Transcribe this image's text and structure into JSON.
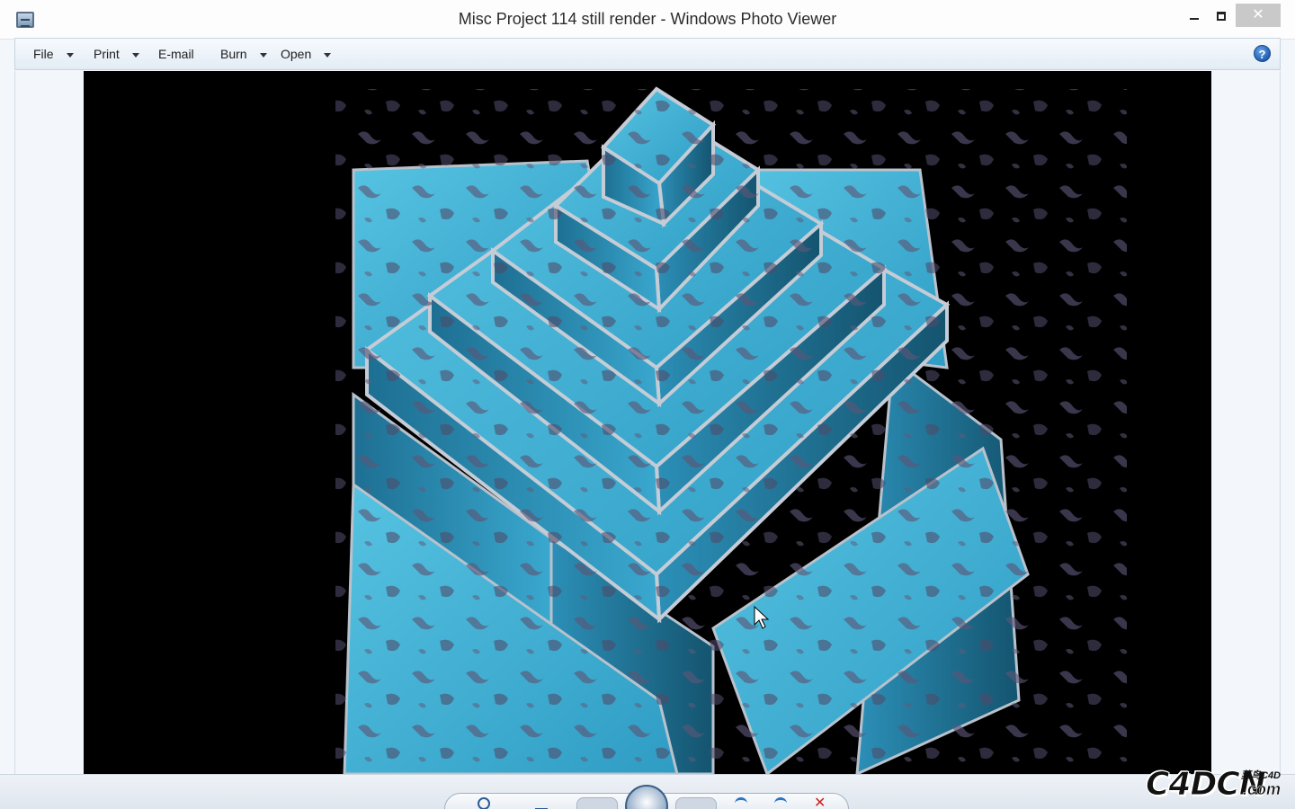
{
  "window": {
    "title": "Misc Project 114 still render - Windows Photo Viewer",
    "controls": {
      "minimize": "",
      "maximize": "",
      "close": "✕"
    }
  },
  "menu": {
    "items": [
      {
        "label": "File",
        "has_dropdown": true
      },
      {
        "label": "Print",
        "has_dropdown": true
      },
      {
        "label": "E-mail",
        "has_dropdown": false
      },
      {
        "label": "Burn",
        "has_dropdown": true
      },
      {
        "label": "Open",
        "has_dropdown": true
      }
    ],
    "help": "?"
  },
  "viewer": {
    "background": "#000000",
    "subject_colors": {
      "paint": "#4ab6d6",
      "rust": "#5a5470",
      "edge": "#c9cdd6"
    }
  },
  "controls_bar": {
    "icons": [
      "zoom-icon",
      "actual-size-icon",
      "previous-icon",
      "slideshow-icon",
      "next-icon",
      "rotate-left-icon",
      "rotate-right-icon",
      "delete-icon"
    ]
  },
  "watermark": {
    "main": "C4DCN",
    "cn": "菜鸟C4D",
    "suffix": ".com"
  }
}
